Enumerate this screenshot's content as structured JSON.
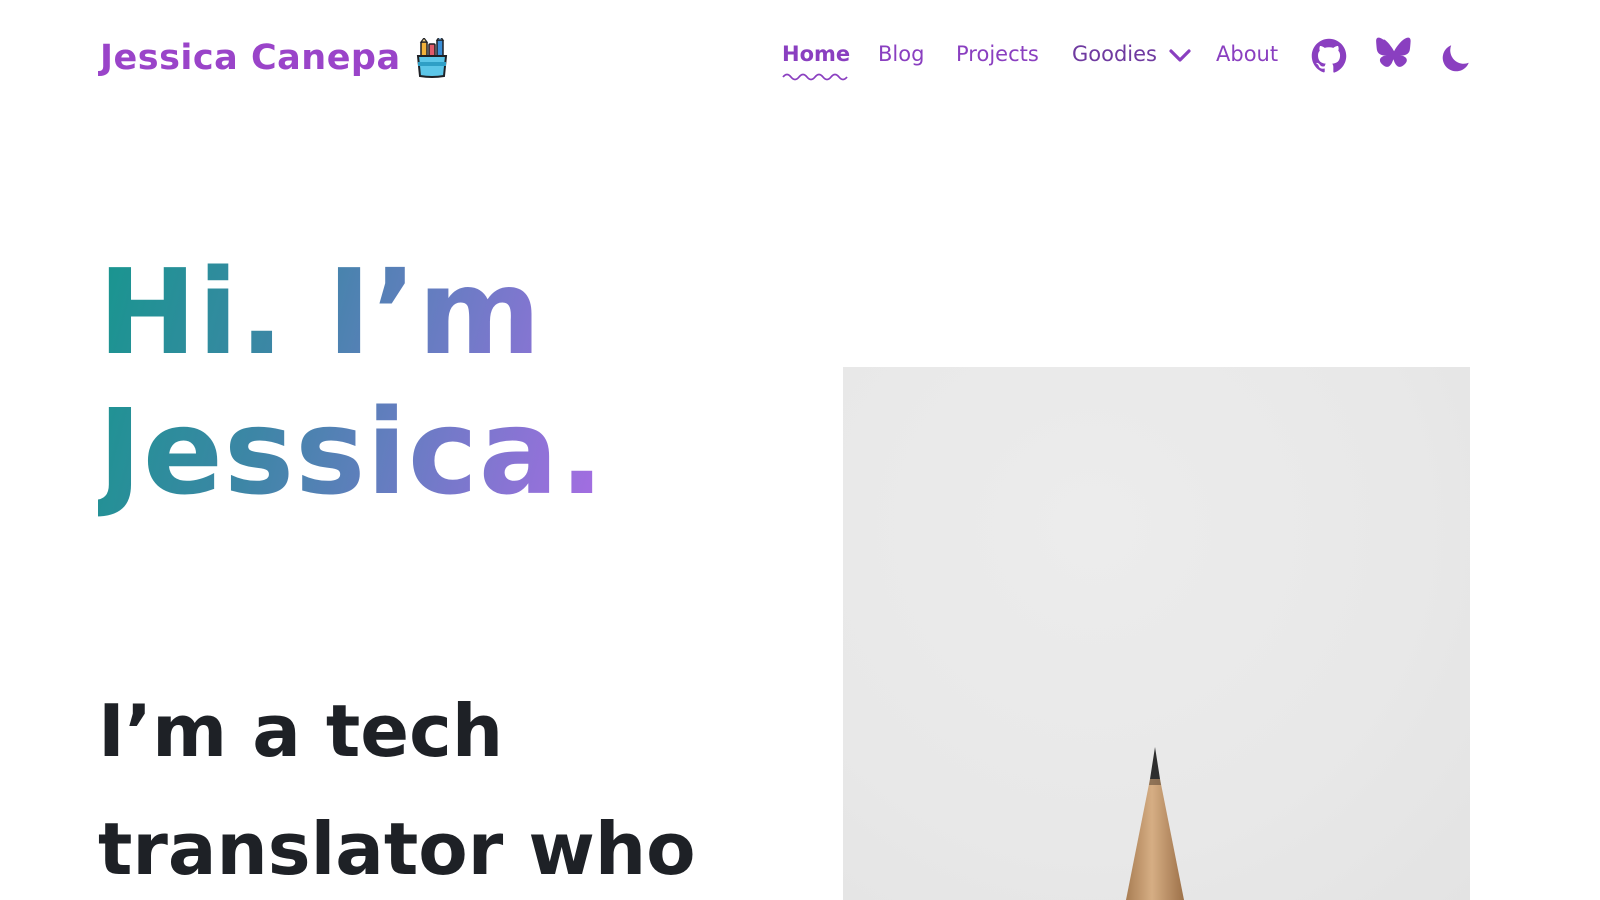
{
  "header": {
    "brand_name": "Jessica Canepa",
    "brand_icon": "pencil-cup-icon",
    "nav": [
      {
        "label": "Home",
        "active": true
      },
      {
        "label": "Blog"
      },
      {
        "label": "Projects"
      },
      {
        "label": "Goodies",
        "has_dropdown": true
      },
      {
        "label": "About"
      }
    ],
    "icons": [
      "github-icon",
      "bluesky-butterfly-icon",
      "dark-mode-moon-icon"
    ]
  },
  "hero": {
    "greeting_line1": "Hi. I’m",
    "greeting_line2": "Jessica.",
    "tagline_line1": "I’m a tech",
    "tagline_line2": "translator who"
  },
  "colors": {
    "accent_purple": "#8a3fc0",
    "gradient_start": "#17968e",
    "gradient_end": "#c476f0",
    "text_dark": "#1e2126"
  }
}
